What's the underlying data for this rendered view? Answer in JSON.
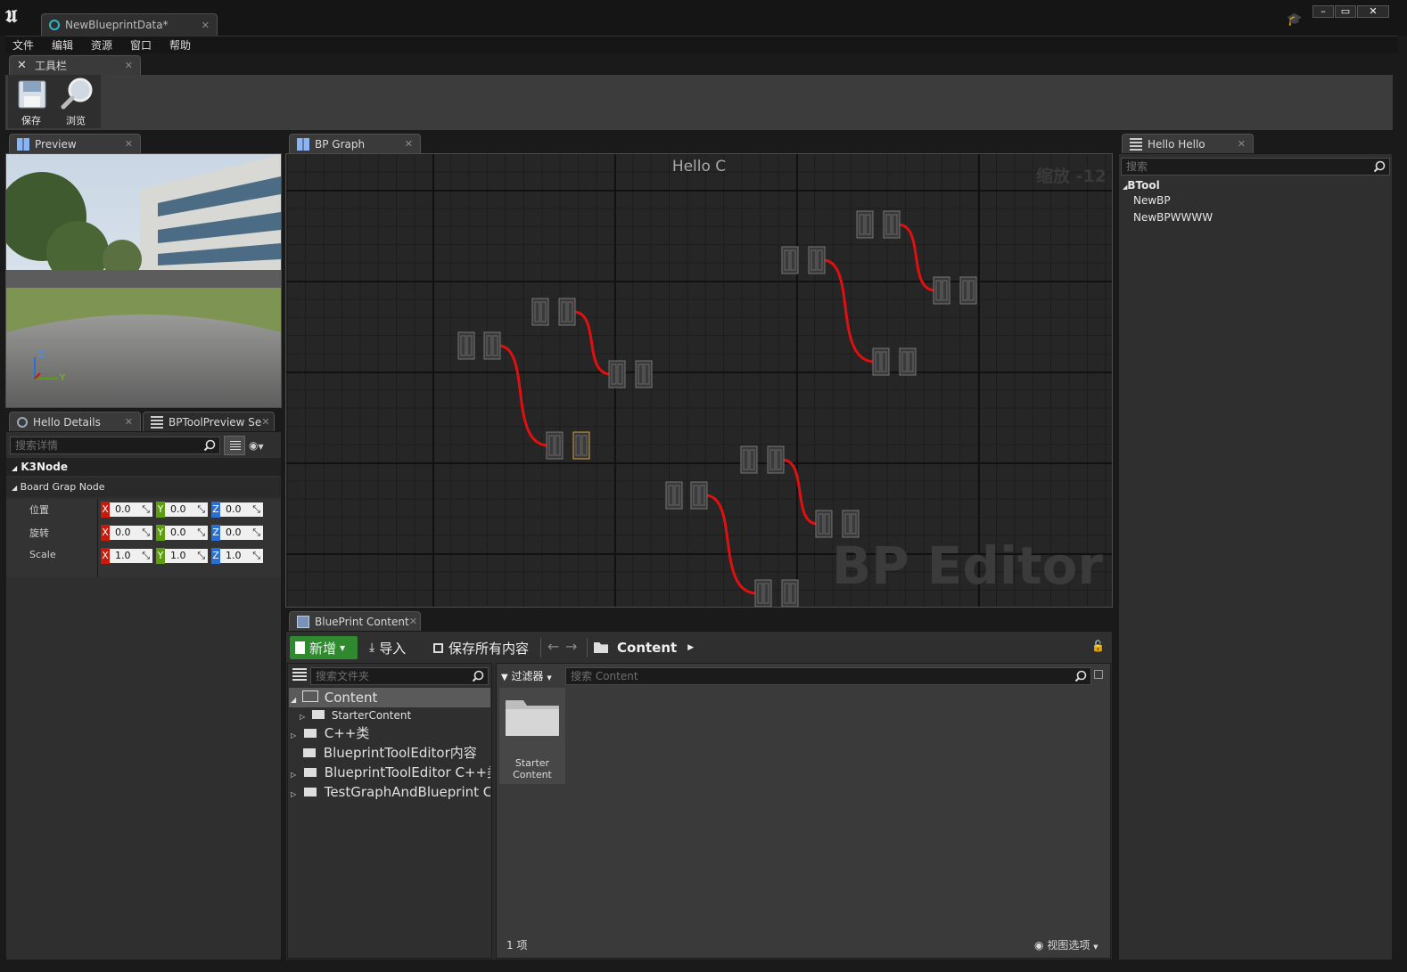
{
  "window": {
    "doc_tab": "NewBlueprintData*",
    "controls": {
      "minimize": "–",
      "maximize": "▭",
      "close": "✕"
    }
  },
  "menu": [
    "文件",
    "编辑",
    "资源",
    "窗口",
    "帮助"
  ],
  "toolbar_tab": "工具栏",
  "toolbar": {
    "save_label": "保存",
    "browse_label": "浏览"
  },
  "preview": {
    "tab": "Preview",
    "axis_z": "Z",
    "axis_y": "Y"
  },
  "details": {
    "tab1": "Hello Details",
    "tab2": "BPToolPreview Se",
    "search_placeholder": "搜索详情",
    "category": "K3Node",
    "section": "Board Grap Node",
    "rows": [
      {
        "label": "位置",
        "x": "0.0",
        "y": "0.0",
        "z": "0.0"
      },
      {
        "label": "旋转",
        "x": "0.0",
        "y": "0.0",
        "z": "0.0"
      },
      {
        "label": "Scale",
        "x": "1.0",
        "y": "1.0",
        "z": "1.0"
      }
    ],
    "axis_x": "X",
    "axis_y": "Y",
    "axis_z": "Z",
    "colors": {
      "x": "#c81a0c",
      "y": "#5d9e0e",
      "z": "#2a6fd6"
    }
  },
  "graph": {
    "tab": "BP Graph",
    "title": "Hello C",
    "zoom": "缩放 -12",
    "watermark": "BP Editor",
    "wire_color": "#e01010"
  },
  "hello": {
    "tab": "Hello Hello",
    "search_placeholder": "搜索",
    "root": "BTool",
    "children": [
      "NewBP",
      "NewBPWWWW"
    ]
  },
  "content": {
    "tab": "BluePrint Content",
    "new_label": "新增",
    "import_label": "导入",
    "save_all_label": "保存所有内容",
    "path": "Content",
    "folder_search_placeholder": "搜索文件夹",
    "filter_label": "过滤器",
    "content_search_placeholder": "搜索 Content",
    "tree": [
      "Content",
      "StarterContent",
      "C++类",
      "BlueprintToolEditor内容",
      "BlueprintToolEditor C++类",
      "TestGraphAndBlueprint C++"
    ],
    "asset_label_line1": "Starter",
    "asset_label_line2": "Content",
    "item_count": "1 项",
    "view_options": "视图选项",
    "accent_color": "#2f8a2f"
  }
}
